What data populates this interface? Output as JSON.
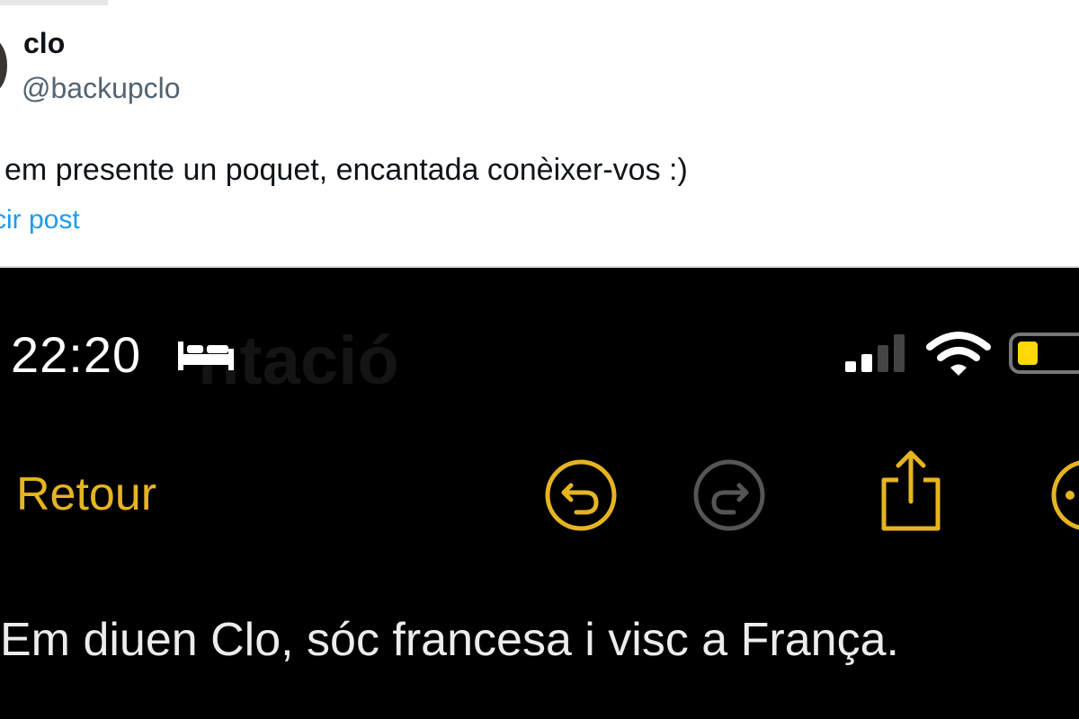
{
  "tweet": {
    "name": "clo",
    "handle": "@backupclo",
    "text": "i em presente un poquet, encantada conèixer-vos :)",
    "translate_link": "cir post"
  },
  "phone": {
    "status_bar": {
      "time": "22:20",
      "icons": [
        "bed-icon",
        "signal-icon",
        "wifi-icon",
        "battery-icon"
      ],
      "ghost_title": "ntació"
    },
    "toolbar": {
      "back_label": "Retour",
      "icons": [
        "undo-icon",
        "redo-icon",
        "share-icon",
        "more-icon"
      ]
    },
    "note_text": "Em diuen Clo, sóc francesa i visc a França."
  },
  "colors": {
    "accent": "#e6b422",
    "link": "#1d9bf0",
    "handle": "#536471",
    "phone_bg": "#000000",
    "battery_fill": "#ffd60a"
  }
}
